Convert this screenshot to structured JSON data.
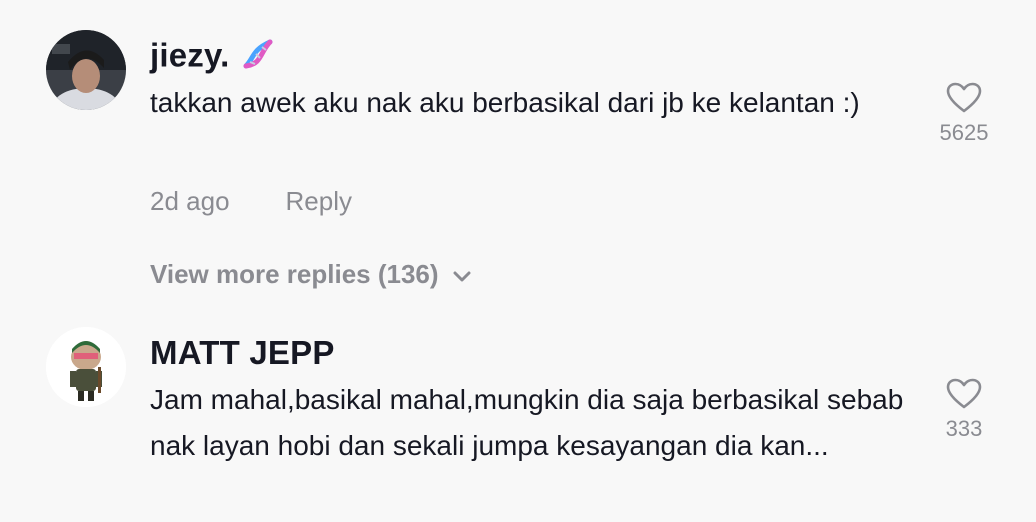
{
  "comments": [
    {
      "username": "jiezy.",
      "username_emoji": "dna-emoji",
      "text": "takkan awek aku nak aku berbasikal dari jb ke kelantan :)",
      "time": "2d ago",
      "reply_label": "Reply",
      "likes": "5625",
      "view_more": "View more replies (136)"
    },
    {
      "username": "MATT JEPP",
      "text": "Jam mahal,basikal mahal,mungkin dia saja berbasikal sebab nak layan hobi dan sekali jumpa kesayangan dia kan...",
      "likes": "333"
    }
  ],
  "colors": {
    "background": "#f8f8f8",
    "primary_text": "#161823",
    "secondary_text": "#8a8b91"
  }
}
